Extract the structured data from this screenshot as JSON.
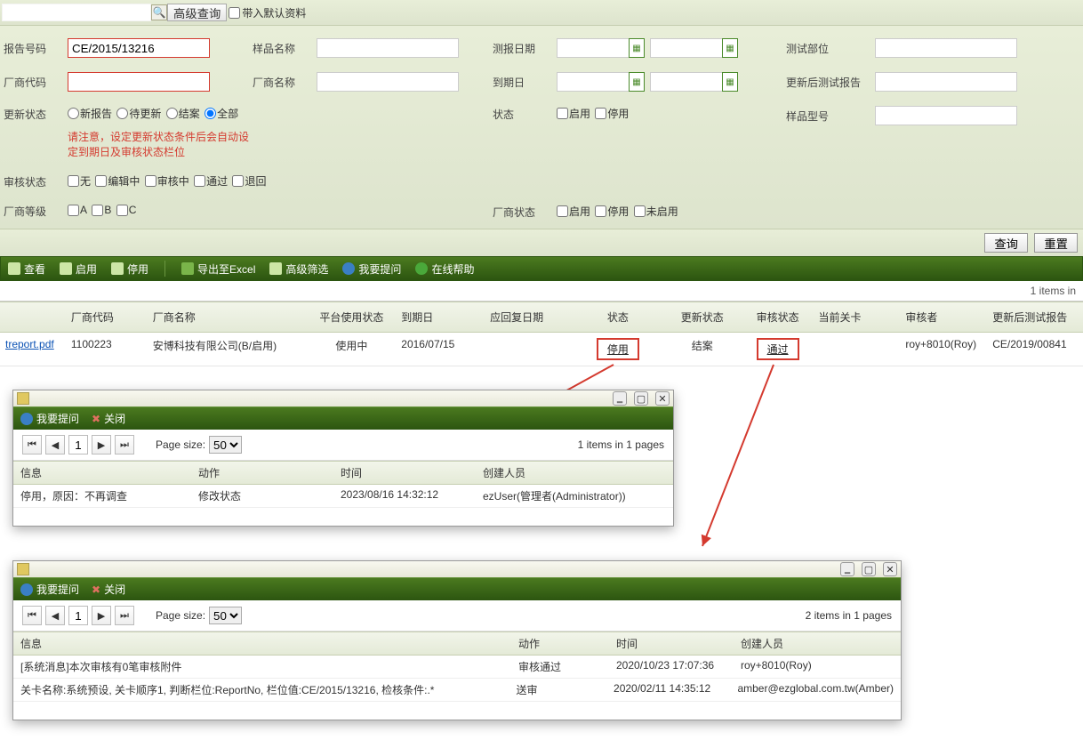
{
  "topbar": {
    "adv_search": "高级查询",
    "bring_default": "带入默认资料"
  },
  "form": {
    "report_no_lbl": "报告号码",
    "report_no_val": "CE/2015/13216",
    "sample_name_lbl": "样品名称",
    "test_date_lbl": "测报日期",
    "test_part_lbl": "测试部位",
    "supplier_code_lbl": "厂商代码",
    "supplier_name_lbl": "厂商名称",
    "due_date_lbl": "到期日",
    "updated_report_lbl": "更新后测试报告",
    "update_status_lbl": "更新状态",
    "status_lbl": "状态",
    "sample_type_lbl": "样品型号",
    "note": "请注意，设定更新状态条件后会自动设定到期日及审核状态栏位",
    "audit_status_lbl": "审核状态",
    "supplier_grade_lbl": "厂商等级",
    "supplier_status_lbl": "厂商状态",
    "upd_r": {
      "new": "新报告",
      "pend": "待更新",
      "close": "结案",
      "all": "全部"
    },
    "st": {
      "enable": "启用",
      "disable": "停用"
    },
    "aud": {
      "none": "无",
      "editing": "编辑中",
      "review": "审核中",
      "pass": "通过",
      "return": "退回"
    },
    "grade": {
      "a": "A",
      "b": "B",
      "c": "C"
    },
    "ss": {
      "enable": "启用",
      "disable": "停用",
      "notyet": "未启用"
    }
  },
  "actions": {
    "query": "查询",
    "reset": "重置"
  },
  "toolbar": {
    "view": "查看",
    "enable": "启用",
    "disable": "停用",
    "export": "导出至Excel",
    "filter": "高级筛选",
    "ask": "我要提问",
    "help": "在线帮助"
  },
  "count_text": "1 items in",
  "grid": {
    "headers": {
      "code": "厂商代码",
      "name": "厂商名称",
      "platform": "平台使用状态",
      "due": "到期日",
      "reply": "应回复日期",
      "status": "状态",
      "upd": "更新状态",
      "audit": "审核状态",
      "gate": "当前关卡",
      "auditor": "审核者",
      "updrep": "更新后测试报告"
    },
    "row": {
      "file": "treport.pdf",
      "code": "1100223",
      "name": "安博科技有限公司(B/启用)",
      "platform": "使用中",
      "due": "2016/07/15",
      "reply": "",
      "status": "停用",
      "upd": "结案",
      "audit": "通过",
      "gate": "",
      "auditor": "roy+8010(Roy)",
      "updrep": "CE/2019/00841"
    }
  },
  "popup_common": {
    "ask": "我要提问",
    "close": "关闭",
    "page_size": "Page size:",
    "size_opt": "50"
  },
  "popup1": {
    "count": "1 items in 1 pages",
    "headers": {
      "info": "信息",
      "action": "动作",
      "time": "时间",
      "creator": "创建人员"
    },
    "rows": [
      {
        "info": "停用，原因：不再调查",
        "action": "修改状态",
        "time": "2023/08/16 14:32:12",
        "creator": "ezUser(管理者(Administrator))"
      }
    ]
  },
  "popup2": {
    "count": "2 items in 1 pages",
    "headers": {
      "info": "信息",
      "action": "动作",
      "time": "时间",
      "creator": "创建人员"
    },
    "rows": [
      {
        "info": "[系统消息]本次审核有0笔审核附件",
        "action": "审核通过",
        "time": "2020/10/23 17:07:36",
        "creator": "roy+8010(Roy)"
      },
      {
        "info": "关卡名称:系统预设, 关卡顺序1, 判断栏位:ReportNo, 栏位值:CE/2015/13216, 检核条件:.*",
        "action": "送审",
        "time": "2020/02/11 14:35:12",
        "creator": "amber@ezglobal.com.tw(Amber)"
      }
    ]
  }
}
